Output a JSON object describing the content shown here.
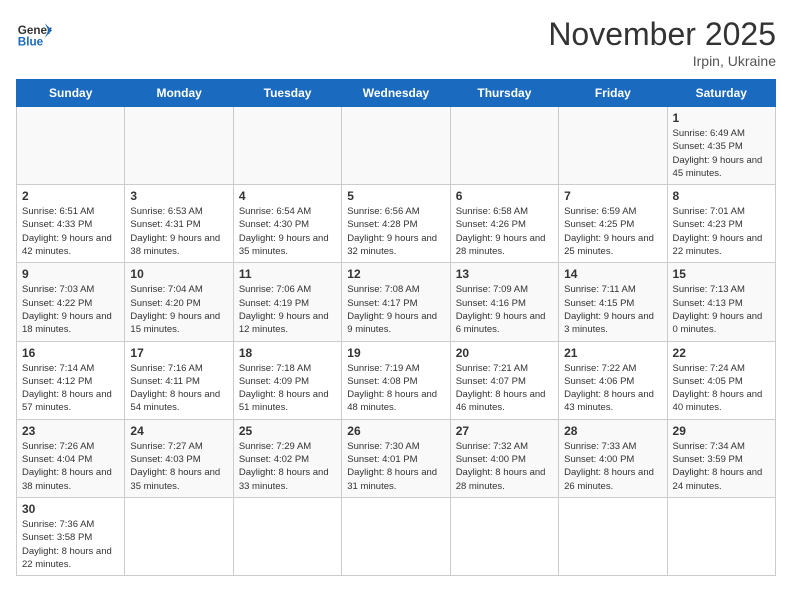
{
  "header": {
    "logo_general": "General",
    "logo_blue": "Blue",
    "month_title": "November 2025",
    "subtitle": "Irpin, Ukraine"
  },
  "days_of_week": [
    "Sunday",
    "Monday",
    "Tuesday",
    "Wednesday",
    "Thursday",
    "Friday",
    "Saturday"
  ],
  "weeks": [
    [
      {
        "day": "",
        "info": ""
      },
      {
        "day": "",
        "info": ""
      },
      {
        "day": "",
        "info": ""
      },
      {
        "day": "",
        "info": ""
      },
      {
        "day": "",
        "info": ""
      },
      {
        "day": "",
        "info": ""
      },
      {
        "day": "1",
        "info": "Sunrise: 6:49 AM\nSunset: 4:35 PM\nDaylight: 9 hours and 45 minutes."
      }
    ],
    [
      {
        "day": "2",
        "info": "Sunrise: 6:51 AM\nSunset: 4:33 PM\nDaylight: 9 hours and 42 minutes."
      },
      {
        "day": "3",
        "info": "Sunrise: 6:53 AM\nSunset: 4:31 PM\nDaylight: 9 hours and 38 minutes."
      },
      {
        "day": "4",
        "info": "Sunrise: 6:54 AM\nSunset: 4:30 PM\nDaylight: 9 hours and 35 minutes."
      },
      {
        "day": "5",
        "info": "Sunrise: 6:56 AM\nSunset: 4:28 PM\nDaylight: 9 hours and 32 minutes."
      },
      {
        "day": "6",
        "info": "Sunrise: 6:58 AM\nSunset: 4:26 PM\nDaylight: 9 hours and 28 minutes."
      },
      {
        "day": "7",
        "info": "Sunrise: 6:59 AM\nSunset: 4:25 PM\nDaylight: 9 hours and 25 minutes."
      },
      {
        "day": "8",
        "info": "Sunrise: 7:01 AM\nSunset: 4:23 PM\nDaylight: 9 hours and 22 minutes."
      }
    ],
    [
      {
        "day": "9",
        "info": "Sunrise: 7:03 AM\nSunset: 4:22 PM\nDaylight: 9 hours and 18 minutes."
      },
      {
        "day": "10",
        "info": "Sunrise: 7:04 AM\nSunset: 4:20 PM\nDaylight: 9 hours and 15 minutes."
      },
      {
        "day": "11",
        "info": "Sunrise: 7:06 AM\nSunset: 4:19 PM\nDaylight: 9 hours and 12 minutes."
      },
      {
        "day": "12",
        "info": "Sunrise: 7:08 AM\nSunset: 4:17 PM\nDaylight: 9 hours and 9 minutes."
      },
      {
        "day": "13",
        "info": "Sunrise: 7:09 AM\nSunset: 4:16 PM\nDaylight: 9 hours and 6 minutes."
      },
      {
        "day": "14",
        "info": "Sunrise: 7:11 AM\nSunset: 4:15 PM\nDaylight: 9 hours and 3 minutes."
      },
      {
        "day": "15",
        "info": "Sunrise: 7:13 AM\nSunset: 4:13 PM\nDaylight: 9 hours and 0 minutes."
      }
    ],
    [
      {
        "day": "16",
        "info": "Sunrise: 7:14 AM\nSunset: 4:12 PM\nDaylight: 8 hours and 57 minutes."
      },
      {
        "day": "17",
        "info": "Sunrise: 7:16 AM\nSunset: 4:11 PM\nDaylight: 8 hours and 54 minutes."
      },
      {
        "day": "18",
        "info": "Sunrise: 7:18 AM\nSunset: 4:09 PM\nDaylight: 8 hours and 51 minutes."
      },
      {
        "day": "19",
        "info": "Sunrise: 7:19 AM\nSunset: 4:08 PM\nDaylight: 8 hours and 48 minutes."
      },
      {
        "day": "20",
        "info": "Sunrise: 7:21 AM\nSunset: 4:07 PM\nDaylight: 8 hours and 46 minutes."
      },
      {
        "day": "21",
        "info": "Sunrise: 7:22 AM\nSunset: 4:06 PM\nDaylight: 8 hours and 43 minutes."
      },
      {
        "day": "22",
        "info": "Sunrise: 7:24 AM\nSunset: 4:05 PM\nDaylight: 8 hours and 40 minutes."
      }
    ],
    [
      {
        "day": "23",
        "info": "Sunrise: 7:26 AM\nSunset: 4:04 PM\nDaylight: 8 hours and 38 minutes."
      },
      {
        "day": "24",
        "info": "Sunrise: 7:27 AM\nSunset: 4:03 PM\nDaylight: 8 hours and 35 minutes."
      },
      {
        "day": "25",
        "info": "Sunrise: 7:29 AM\nSunset: 4:02 PM\nDaylight: 8 hours and 33 minutes."
      },
      {
        "day": "26",
        "info": "Sunrise: 7:30 AM\nSunset: 4:01 PM\nDaylight: 8 hours and 31 minutes."
      },
      {
        "day": "27",
        "info": "Sunrise: 7:32 AM\nSunset: 4:00 PM\nDaylight: 8 hours and 28 minutes."
      },
      {
        "day": "28",
        "info": "Sunrise: 7:33 AM\nSunset: 4:00 PM\nDaylight: 8 hours and 26 minutes."
      },
      {
        "day": "29",
        "info": "Sunrise: 7:34 AM\nSunset: 3:59 PM\nDaylight: 8 hours and 24 minutes."
      }
    ],
    [
      {
        "day": "30",
        "info": "Sunrise: 7:36 AM\nSunset: 3:58 PM\nDaylight: 8 hours and 22 minutes."
      },
      {
        "day": "",
        "info": ""
      },
      {
        "day": "",
        "info": ""
      },
      {
        "day": "",
        "info": ""
      },
      {
        "day": "",
        "info": ""
      },
      {
        "day": "",
        "info": ""
      },
      {
        "day": "",
        "info": ""
      }
    ]
  ]
}
